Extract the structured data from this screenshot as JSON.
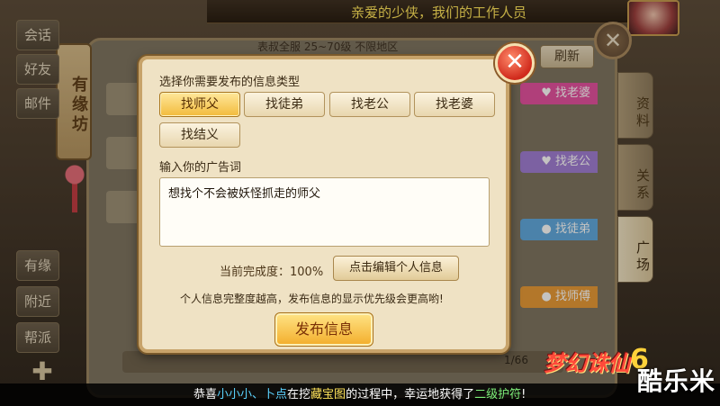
{
  "top_marquee": "亲爱的少侠，我们的工作人员",
  "sidebar": {
    "upper": [
      "会话",
      "好友",
      "邮件"
    ],
    "lower": [
      "有缘",
      "附近",
      "帮派"
    ],
    "plus_icon": "plus-icon"
  },
  "banner": "有缘坊",
  "background_panel": {
    "filter_text": "表叔全服 25~70级 不限地区",
    "refresh_label": "刷新",
    "right_tags": [
      "找老婆",
      "找老公",
      "找徒弟",
      "找师傅"
    ],
    "right_tabs": [
      "资料",
      "关系",
      "广场"
    ],
    "page_count": "1/66"
  },
  "modal": {
    "type_label": "选择你需要发布的信息类型",
    "types": [
      "找师父",
      "找徒弟",
      "找老公",
      "找老婆",
      "找结义"
    ],
    "selected_type": "找师父",
    "ad_label": "输入你的广告词",
    "ad_text": "想找个不会被妖怪抓走的师父",
    "completion": "当前完成度：100%",
    "edit_button": "点击编辑个人信息",
    "tip": "个人信息完整度越高，发布信息的显示优先级会更高哟!",
    "publish_button": "发布信息",
    "close_icon": "close-icon"
  },
  "system_message": {
    "prefix": "恭喜",
    "name1": "小小小、卜点",
    "mid1": "在挖",
    "item1": "藏宝图",
    "mid2": "的过程中，幸运地获得了",
    "item2": "二级护符",
    "suffix": "!"
  },
  "logo": "梦幻诛仙",
  "logo_num": "6",
  "watermark": "酷乐米",
  "colors": {
    "selected_type": "#f2bb3c",
    "modal_bg": "#efe2c4",
    "close_red": "#d02a1c",
    "marquee_yellow": "#ffe45a"
  }
}
